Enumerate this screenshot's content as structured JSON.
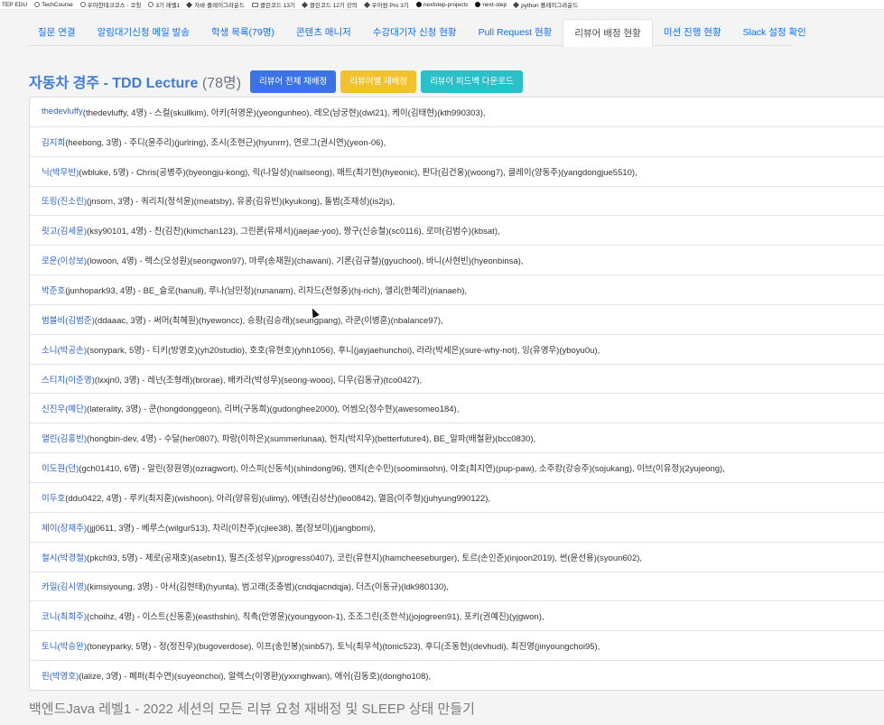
{
  "bookmarks": [
    {
      "label": "TEP EDU",
      "icon": "none"
    },
    {
      "label": "TechCourse",
      "icon": "globe-icon"
    },
    {
      "label": "우아한테크코스 - 코칭",
      "icon": "globe-icon"
    },
    {
      "label": "3기 레벨1",
      "icon": "globe-icon"
    },
    {
      "label": "자바 플레이그라운드",
      "icon": "diamond-icon"
    },
    {
      "label": "클린코드 13기",
      "icon": "folder-icon"
    },
    {
      "label": "클린코드 12기 강의",
      "icon": "diamond-icon"
    },
    {
      "label": "우아원 Pro 3기",
      "icon": "diamond-icon"
    },
    {
      "label": "nextstep-projects",
      "icon": "github-icon"
    },
    {
      "label": "next-step",
      "icon": "github-icon"
    },
    {
      "label": "python 플레이그라운드",
      "icon": "diamond-icon"
    }
  ],
  "tabs": [
    {
      "label": "질문 연결"
    },
    {
      "label": "알림대기신청 메일 발송"
    },
    {
      "label": "학생 목록(79명)"
    },
    {
      "label": "콘텐츠 매니저"
    },
    {
      "label": "수강대기자 신청 현황"
    },
    {
      "label": "Pull Request 현황"
    },
    {
      "label": "리뷰어 배정 현황",
      "active": true
    },
    {
      "label": "미션 진행 현황"
    },
    {
      "label": "Slack 설정 확인"
    }
  ],
  "heading": {
    "title": "자동차 경주 - TDD Lecture",
    "count": "(78명)"
  },
  "buttons": {
    "reassign_all": "리뷰어 전체 재배정",
    "reassign_by_reviewer": "리뷰어별 재배정",
    "download_feedback": "리뷰이 피드백 다운로드"
  },
  "colors": {
    "link": "#2b63c9",
    "title": "#3f7bd9",
    "btn_blue": "#3b73e6",
    "btn_yellow": "#f2c12e",
    "btn_teal": "#2bbfc8"
  },
  "rows": [
    {
      "reviewer": "thedevluffy",
      "detail": "(thedevluffy, 4명) - 스컬(skullkim), 아키(허영운)(yeongunheo), 레오(남궁현)(dwl21), 케이(김태현)(kth990303),"
    },
    {
      "reviewer": "김지희",
      "detail": "(heebong, 3명) - 주디(윤주리)(jurlring), 조시(조현근)(hyunrrr), 연로그(권시연)(yeon-06),"
    },
    {
      "reviewer": "닉(박우빈)",
      "detail": "(wbluke, 5명) - Chris(공병주)(byeongju-kong), 릭(나일성)(nailseong), 매트(최기현)(hyeonic), 판다(김건웅)(woong7), 클레이(양동주)(yangdongjue5510),"
    },
    {
      "reviewer": "또링(진소린)",
      "detail": "(jnsorn, 3명) - 쿼리치(정석윤)(meatsby), 유콩(김유빈)(kyukong), 돌범(조재성)(is2js),"
    },
    {
      "reviewer": "릿고(김세윤)",
      "detail": "(ksy90101, 4명) - 찬(김찬)(kimchan123), 그린론(유재서)(jaejae-yoo), 짱구(신승철)(sc0116), 로마(김범수)(kbsat),"
    },
    {
      "reviewer": "로운(이상보)",
      "detail": "(lowoon, 4명) - 렉스(오성원)(seongwon97), 마루(송채원)(chawani), 기론(김규철)(gyuchool), 바니(사현빈)(hyeonbinsa),"
    },
    {
      "reviewer": "박준호",
      "detail": "(junhopark93, 4명) - BE_슬로(hanull), 루나(남민정)(runanam), 리차드(전형중)(hj-rich), 엘리(한혜리)(rianaeh),"
    },
    {
      "reviewer": "범블비(김범준)",
      "detail": "(ddaaac, 3명) - 써머(최혜원)(hyewoncc), 승팡(김승래)(seungpang), 라쿤(이병훈)(nbalance97),"
    },
    {
      "reviewer": "소니(박공손)",
      "detail": "(sonypark, 5명) - 티키(방영호)(yh20studio), 호호(유현호)(yhh1056), 후니(jayjaehunchoi), 라라(박세은)(sure-why-not), 잉(유영우)(yboyu0u),"
    },
    {
      "reviewer": "스티치(이준영)",
      "detail": "(lxxjn0, 3명) - 레넌(조형래)(brorae), 배카라(박성우)(seong-wooo), 디우(김동규)(tco0427),"
    },
    {
      "reviewer": "신진우(예단)",
      "detail": "(laterality, 3명) - 쿤(hongdonggeon), 리버(구동희)(gudonghee2000), 어썸오(정수현)(awesomeo184),"
    },
    {
      "reviewer": "앨린(김홍빈)",
      "detail": "(hongbin-dev, 4명) - 수달(her0807), 파랑(이하은)(summerlunaa), 헌치(박지우)(betterfuture4), BE_알파(배철환)(bcc0830),"
    },
    {
      "reviewer": "이도원(던)",
      "detail": "(gch01410, 6명) - 알린(장원영)(ozragwort), 아스피(신동석)(shindong96), 앤지(손수민)(soominsohn), 야호(최지연)(pup-paw), 소주캉(강승주)(sojukang), 이브(이유정)(2yujeong),"
    },
    {
      "reviewer": "이두호",
      "detail": "(ddu0422, 4명) - 루키(최지훈)(wishoon), 아리(양유림)(ulimy), 에덴(김성산)(leo0842), 열음(이주형)(juhyung990122),"
    },
    {
      "reviewer": "제이(장재주)",
      "detail": "(jjj0611, 3명) - 베루스(wilgur513), 차리(이찬주)(cjlee38), 봄(장보미)(jangbomi),"
    },
    {
      "reviewer": "철시(박경철)",
      "detail": "(pkch93, 5명) - 제로(공재호)(asebn1), 필즈(조성우)(progress0407), 코린(유현지)(hamcheeseburger), 토르(손인준)(injoon2019), 썬(윤선용)(syoun602),"
    },
    {
      "reviewer": "카일(김시영)",
      "detail": "(kimsiyoung, 3명) - 아서(김현태)(hyunta), 범고래(조충범)(cndqjacndqja), 더즈(이동규)(ldk980130),"
    },
    {
      "reviewer": "코니(최희주)",
      "detail": "(choihz, 4명) - 이스트(신동훈)(easthshin), 칙촉(안영윤)(youngyoon-1), 조조그린(조한석)(jojogreen91), 포키(권예진)(yjgwon),"
    },
    {
      "reviewer": "토니(박승완)",
      "detail": "(toneyparky, 5명) - 정(정진우)(bugoverdose), 이프(송인봉)(sinb57), 토닉(최우석)(tonic523), 후디(조동현)(devhudi), 최진영(jinyoungchoi95),"
    },
    {
      "reviewer": "핀(박영호)",
      "detail": "(lalize, 3명) - 페퍼(최수연)(suyeonchoi), 알렉스(이영환)(yxxnghwan), 애쉬(김동호)(dongho108),"
    }
  ],
  "next_section_title": "백엔드Java 레벨1 - 2022 세션의 모든 리뷰 요청 재배정 및 SLEEP 상태 만들기"
}
